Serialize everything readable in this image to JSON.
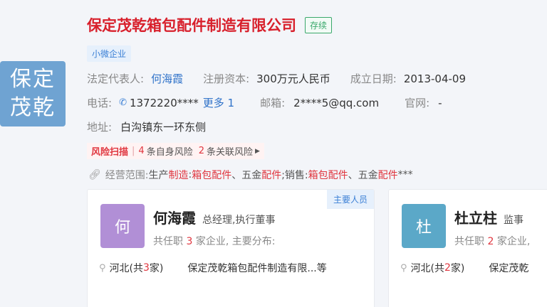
{
  "logo": {
    "line1": "保定",
    "line2": "茂乾",
    "bg": "#6fa3d2"
  },
  "company": {
    "name": "保定茂乾箱包配件制造有限公司",
    "status": "存续",
    "tag": "小微企业"
  },
  "info": {
    "legal_label": "法定代表人:",
    "legal_value": "何海霞",
    "capital_label": "注册资本:",
    "capital_value": "300万元人民币",
    "date_label": "成立日期:",
    "date_value": "2013-04-09",
    "phone_label": "电话:",
    "phone_value": "1372220****",
    "phone_more": "更多 1",
    "email_label": "邮箱:",
    "email_value": "2****5@qq.com",
    "site_label": "官网:",
    "site_value": "-",
    "addr_label": "地址:",
    "addr_value": "白沟镇东一环东侧"
  },
  "risk": {
    "label": "风险扫描",
    "self_count": "4",
    "self_text": "条自身风险",
    "rel_count": "2",
    "rel_text": "条关联风险"
  },
  "scope": {
    "label": "经营范围:",
    "p1": "生产",
    "h1": "制造",
    "p2": ":",
    "h2": "箱包配件",
    "p3": "、五金",
    "h3": "配件",
    "p4": ";销售:",
    "h4": "箱包配件",
    "p5": "、五金",
    "h5": "配件",
    "p6": "***"
  },
  "people": [
    {
      "avatar": "何",
      "avatar_color": "#b18fd6",
      "name": "何海霞",
      "role": "总经理,执行董事",
      "badge": "主要人员",
      "line_a": "共任职",
      "count": "3",
      "line_b": "家企业, 主要分布:",
      "loc_a": "河北(共",
      "loc_n": "3",
      "loc_b": "家)",
      "company": "保定茂乾箱包配件制造有限...等"
    },
    {
      "avatar": "杜",
      "avatar_color": "#5ba8c8",
      "name": "杜立柱",
      "role": "监事",
      "line_a": "共任职",
      "count": "2",
      "line_b": "家企业,",
      "loc_a": "河北(共",
      "loc_n": "2",
      "loc_b": "家)",
      "company": "保定茂乾"
    }
  ]
}
